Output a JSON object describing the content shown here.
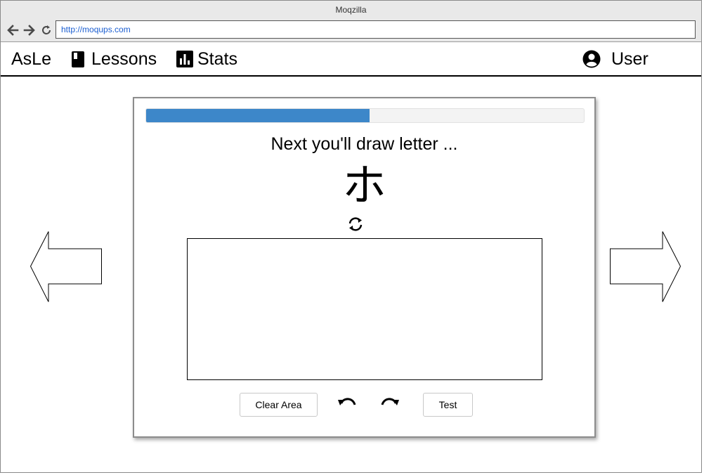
{
  "browser": {
    "title": "Moqzilla",
    "url": "http://moqups.com",
    "back_icon": "arrow-left-icon",
    "forward_icon": "arrow-right-icon",
    "reload_icon": "reload-icon"
  },
  "nav": {
    "brand": "AsLe",
    "lessons_label": "Lessons",
    "lessons_icon": "book-icon",
    "stats_label": "Stats",
    "stats_icon": "bar-chart-icon",
    "user_label": "User",
    "user_icon": "user-circle-icon"
  },
  "lesson": {
    "progress_percent": 51,
    "progress_color": "#3d87c9",
    "prompt": "Next you'll draw letter ...",
    "letter": "ホ",
    "refresh_icon": "refresh-icon",
    "clear_label": "Clear Area",
    "undo_icon": "undo-icon",
    "redo_icon": "redo-icon",
    "test_label": "Test"
  },
  "arrows": {
    "prev_icon": "arrow-left-outline-icon",
    "next_icon": "arrow-right-outline-icon"
  }
}
